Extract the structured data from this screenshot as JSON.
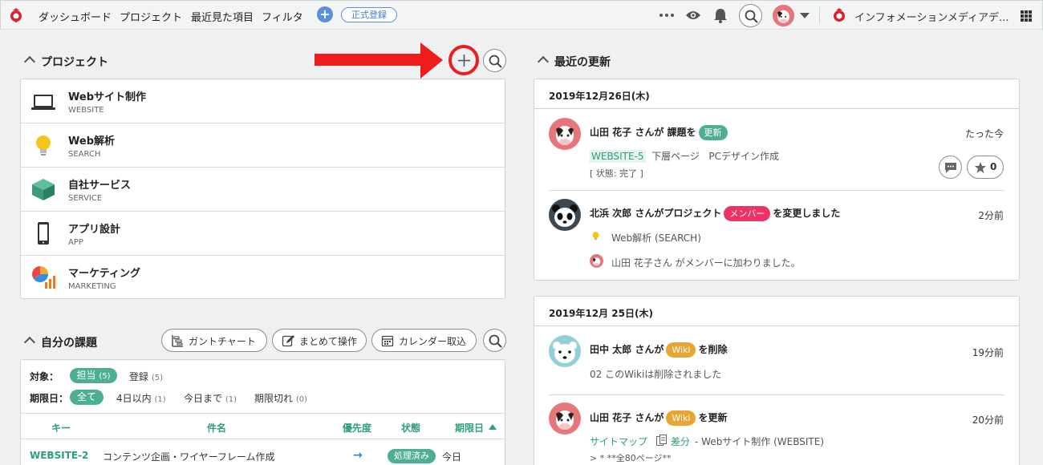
{
  "header": {
    "nav": [
      "ダッシュボード",
      "プロジェクト",
      "最近見た項目",
      "フィルタ"
    ],
    "register": "正式登録",
    "space_name": "インフォメーションメディアデ..."
  },
  "projects": {
    "title": "プロジェクト",
    "items": [
      {
        "name": "Webサイト制作",
        "key": "WEBSITE",
        "icon": "laptop-icon"
      },
      {
        "name": "Web解析",
        "key": "SEARCH",
        "icon": "lightbulb-icon"
      },
      {
        "name": "自社サービス",
        "key": "SERVICE",
        "icon": "box-icon"
      },
      {
        "name": "アプリ設計",
        "key": "APP",
        "icon": "smartphone-icon"
      },
      {
        "name": "マーケティング",
        "key": "MARKETING",
        "icon": "chart-icon"
      }
    ]
  },
  "issues": {
    "title": "自分の課題",
    "buttons": [
      "ガントチャート",
      "まとめて操作",
      "カレンダー取込"
    ],
    "filter_target_label": "対象：",
    "filter_target": [
      {
        "label": "担当",
        "count": "(5)"
      },
      {
        "label": "登録",
        "count": "(5)"
      }
    ],
    "filter_due_label": "期限日：",
    "filter_due": [
      {
        "label": "全て",
        "count": ""
      },
      {
        "label": "4日以内",
        "count": "(1)"
      },
      {
        "label": "今日まで",
        "count": "(1)"
      },
      {
        "label": "期限切れ",
        "count": "(0)"
      }
    ],
    "columns": [
      "キー",
      "件名",
      "優先度",
      "状態",
      "期限日"
    ],
    "rows": [
      {
        "key": "WEBSITE-2",
        "subject": "コンテンツ企画・ワイヤーフレーム作成",
        "priority": "→",
        "status": "処理済み",
        "due": "今日"
      }
    ]
  },
  "updates": {
    "title": "最近の更新",
    "groups": [
      {
        "date": "2019年12月26日(木)",
        "entries": [
          {
            "pre": "山田 花子 さんが 課題を",
            "badge": "更新",
            "badge_color": "#4caf94",
            "post": "",
            "time": "たった今",
            "key": "WEBSITE-5",
            "line1a": "下層ページ",
            "line1b": "PCデザイン作成",
            "line2": "[ 状態: 完了 ]",
            "star": "0"
          },
          {
            "pre": "北浜 次郎 さんがプロジェクト",
            "badge": "メンバー",
            "badge_color": "#ec3266",
            "post": "を変更しました",
            "time": "2分前",
            "line1": "Web解析 (SEARCH)",
            "line2": "山田 花子さん がメンバーに加わりました。"
          }
        ]
      },
      {
        "date": "2019年12月 25日(木)",
        "entries": [
          {
            "pre": "田中 太郎 さんが",
            "badge": "Wiki",
            "badge_color": "#e8a531",
            "post": "を削除",
            "time": "19分前",
            "line1": "02 このWikiは削除されました"
          },
          {
            "pre": "山田 花子 さんが",
            "badge": "Wiki",
            "badge_color": "#e8a531",
            "post": "を更新",
            "time": "20分前",
            "link1": "サイトマップ",
            "link2": "差分",
            "line1": "- Webサイト制作 (WEBSITE)",
            "line2": "> * **全80ページ**"
          }
        ]
      }
    ]
  },
  "colors": {
    "accent": "#4caf94",
    "arrow": "#ee1c1c",
    "brand": "#d9232e"
  }
}
